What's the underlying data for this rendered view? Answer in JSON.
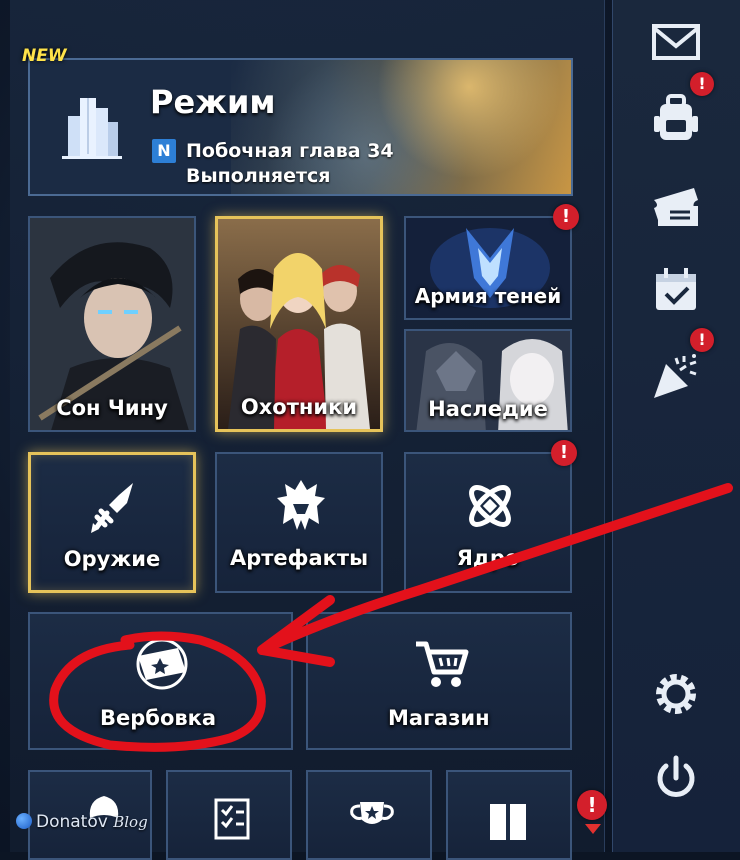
{
  "mode": {
    "new_tag": "NEW",
    "title": "Режим",
    "chapter_badge": "N",
    "chapter": "Побочная глава 34",
    "status": "Выполняется"
  },
  "tiles": {
    "sung_jinwoo": "Сон Чину",
    "hunters": "Охотники",
    "shadow_army": "Армия теней",
    "legacy": "Наследие",
    "weapons": "Оружие",
    "artifacts": "Артефакты",
    "core": "Ядро",
    "recruit": "Вербовка",
    "shop": "Магазин"
  },
  "alert_symbol": "!",
  "sidebar": {
    "icons": [
      "mail-icon",
      "backpack-icon",
      "ticket-icon",
      "calendar-check-icon",
      "party-popper-icon",
      "settings-icon",
      "power-icon"
    ]
  },
  "footer": {
    "brand": "Donatov",
    "blog": "Blog"
  },
  "colors": {
    "gold_frame": "#e6c35a",
    "alert_red": "#d31f2b",
    "annotation_red": "#e3111b",
    "tile_border": "#3b557a"
  }
}
